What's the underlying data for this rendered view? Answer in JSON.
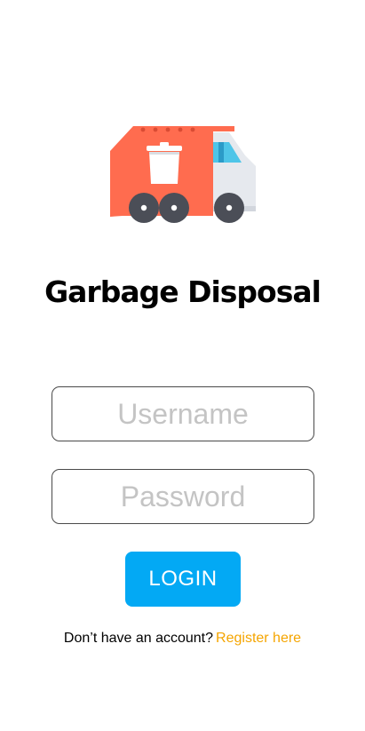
{
  "app": {
    "logo_icon": "garbage-truck-icon",
    "title": "Garbage Disposal"
  },
  "form": {
    "username": {
      "value": "",
      "placeholder": "Username"
    },
    "password": {
      "value": "",
      "placeholder": "Password"
    },
    "login_label": "LOGIN"
  },
  "register": {
    "prompt": "Don’t have an account?",
    "link_label": "Register here"
  },
  "colors": {
    "truck_body": "#ff6c4f",
    "truck_cab": "#e6e9ee",
    "truck_window": "#4ec5e8",
    "wheels": "#4b4e57",
    "login_button": "#03a9f4",
    "register_link": "#f5a500",
    "input_border": "#4a4a4a",
    "placeholder": "#c4c4c4"
  }
}
